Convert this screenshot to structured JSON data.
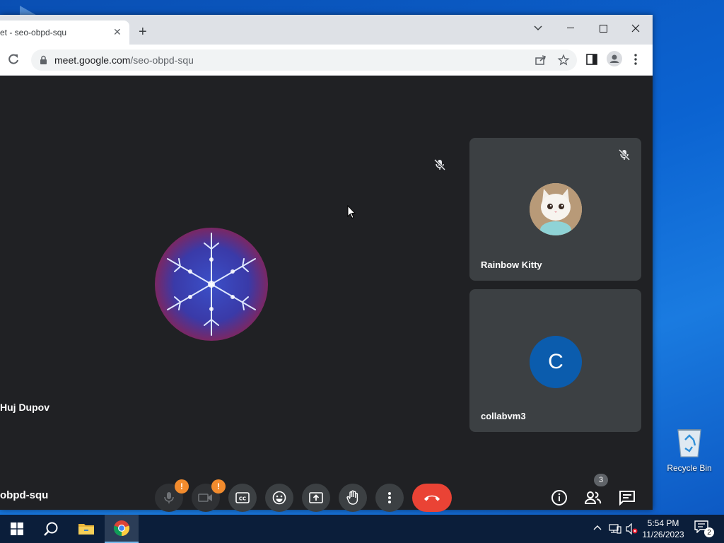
{
  "browser": {
    "tab_title": "et - seo-obpd-squ",
    "url_host": "meet.google.com",
    "url_path": "/seo-obpd-squ"
  },
  "meet": {
    "main_participant_name": "Huj Dupov",
    "meeting_code": "obpd-squ",
    "participants": [
      {
        "name": "Rainbow Kitty",
        "muted": true
      },
      {
        "name": "collabvm3",
        "initial": "C",
        "avatar_color": "#0b5cad"
      }
    ],
    "warning_badge": "!",
    "people_count": "3",
    "end_call_color": "#ea4335"
  },
  "desktop": {
    "recycle_bin_label": "Recycle Bin"
  },
  "taskbar": {
    "time": "5:54 PM",
    "date": "11/26/2023",
    "notification_count": "2"
  }
}
